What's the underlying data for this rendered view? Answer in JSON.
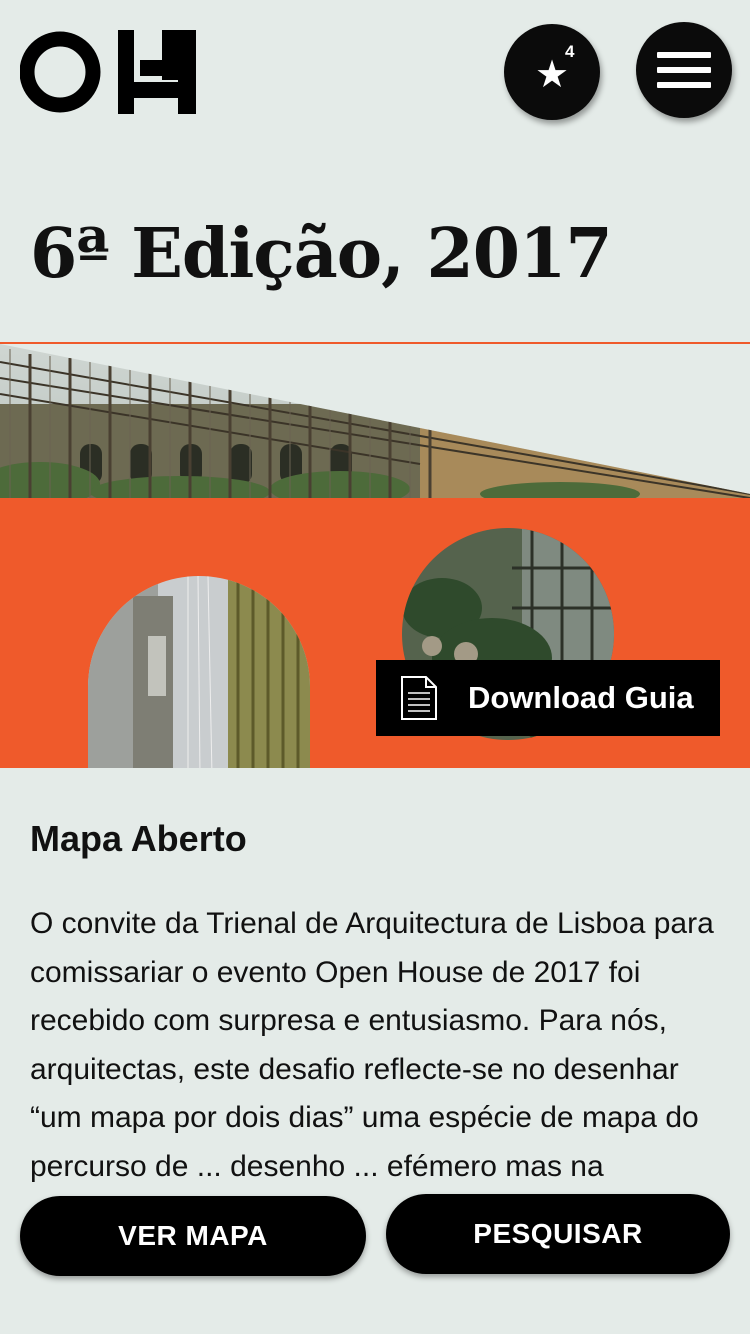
{
  "header": {
    "logo": "OH",
    "favorites_icon": "star-icon",
    "favorites_count": "4",
    "menu_icon": "hamburger-icon"
  },
  "edition": {
    "title": "6ª Edição, 2017"
  },
  "download": {
    "label": "Download Guia",
    "icon": "document-icon"
  },
  "article": {
    "title": "Mapa Aberto",
    "body": "O convite da Trienal de Arquitectura de Lisboa para comissariar o evento Open House de 2017 foi recebido com surpresa e entusiasmo. Para nós, arquitectas, este desafio reflecte-se no desenhar “um mapa por dois dias” uma espécie de mapa do percurso de ... desenho ... efémero mas na realidade, este é sempre"
  },
  "bottom_bar": {
    "map_label": "VER MAPA",
    "search_label": "PESQUISAR"
  },
  "colors": {
    "background": "#e4ebe8",
    "accent": "#ef5a2b",
    "dark": "#000000"
  }
}
